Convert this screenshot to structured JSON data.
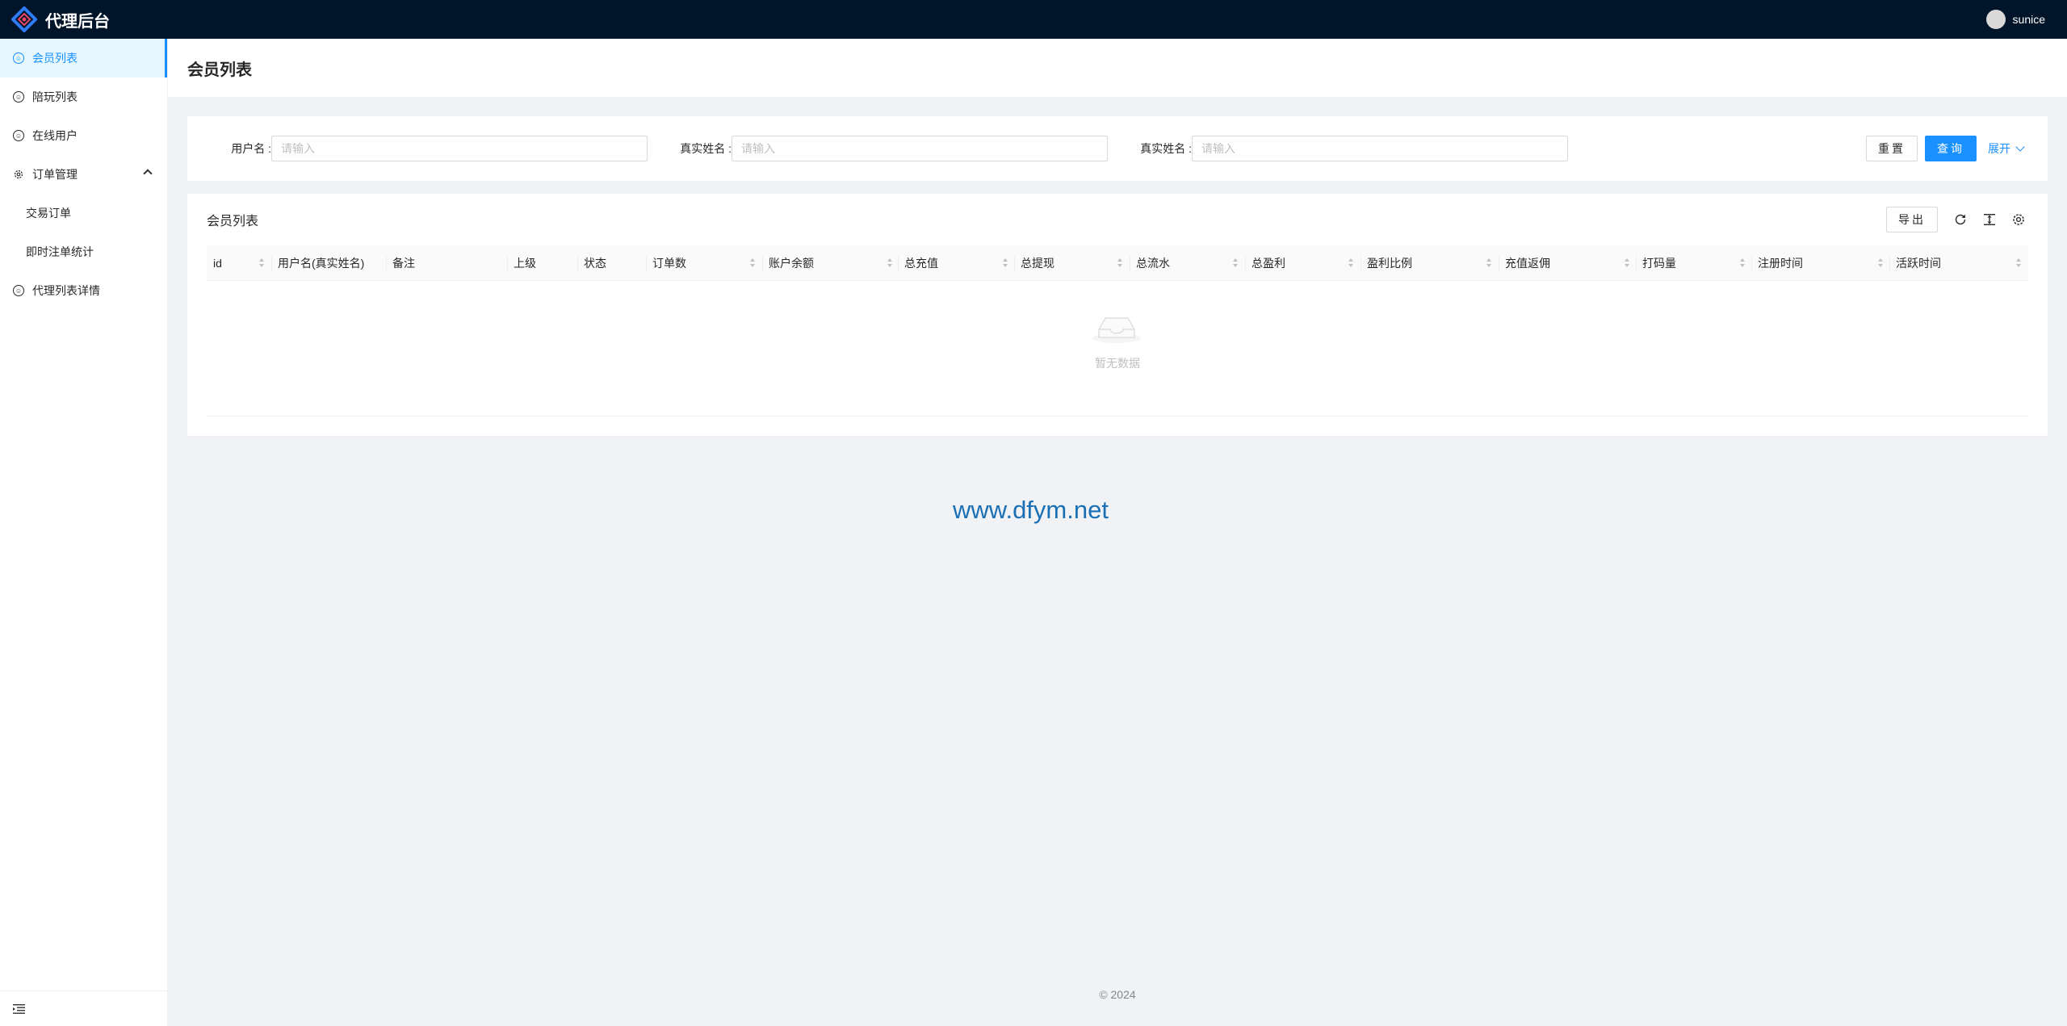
{
  "app": {
    "title": "代理后台",
    "user": "sunice"
  },
  "sidebar": {
    "items": [
      {
        "label": "会员列表"
      },
      {
        "label": "陪玩列表"
      },
      {
        "label": "在线用户"
      },
      {
        "label": "订单管理"
      },
      {
        "label": "交易订单"
      },
      {
        "label": "即时注单统计"
      },
      {
        "label": "代理列表详情"
      }
    ]
  },
  "page": {
    "title": "会员列表"
  },
  "search": {
    "fields": [
      {
        "label": "用户名 :",
        "placeholder": "请输入"
      },
      {
        "label": "真实姓名 :",
        "placeholder": "请输入"
      },
      {
        "label": "真实姓名 :",
        "placeholder": "请输入"
      }
    ],
    "reset_label": "重置",
    "query_label": "查询",
    "expand_label": "展开"
  },
  "table": {
    "title": "会员列表",
    "export_label": "导出",
    "columns": [
      "id",
      "用户名(真实姓名)",
      "备注",
      "上级",
      "状态",
      "订单数",
      "账户余额",
      "总充值",
      "总提现",
      "总流水",
      "总盈利",
      "盈利比例",
      "充值返佣",
      "打码量",
      "注册时间",
      "活跃时间"
    ],
    "empty_text": "暂无数据"
  },
  "watermark": "www.dfym.net",
  "footer": "© 2024",
  "colors": {
    "accent": "#1890ff",
    "header_bg": "#001529",
    "page_bg": "#f0f2f5"
  }
}
